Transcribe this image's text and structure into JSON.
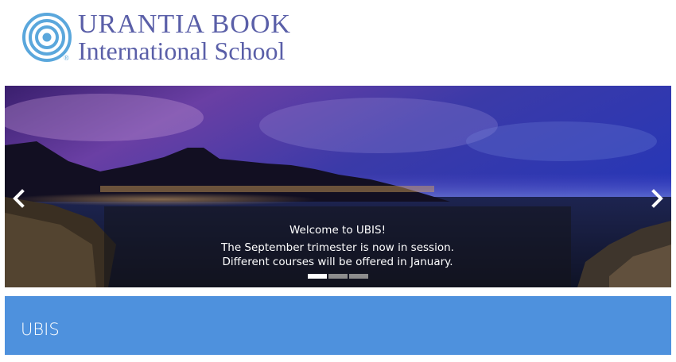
{
  "brand": {
    "line1": "URANTIA BOOK",
    "line2": "International School",
    "registered_mark": "®",
    "colors": {
      "text": "#5a5fa8",
      "logo": "#5aa7dc"
    }
  },
  "carousel": {
    "caption": {
      "title": "Welcome to UBIS!",
      "line1": "The September trimester is now in session.",
      "line2": "Different courses will be offered in January."
    },
    "slides_total": 3,
    "active_slide": 1,
    "prev_icon": "chevron-left-icon",
    "next_icon": "chevron-right-icon"
  },
  "band": {
    "title": "UBIS",
    "color": "#4e91dd"
  }
}
